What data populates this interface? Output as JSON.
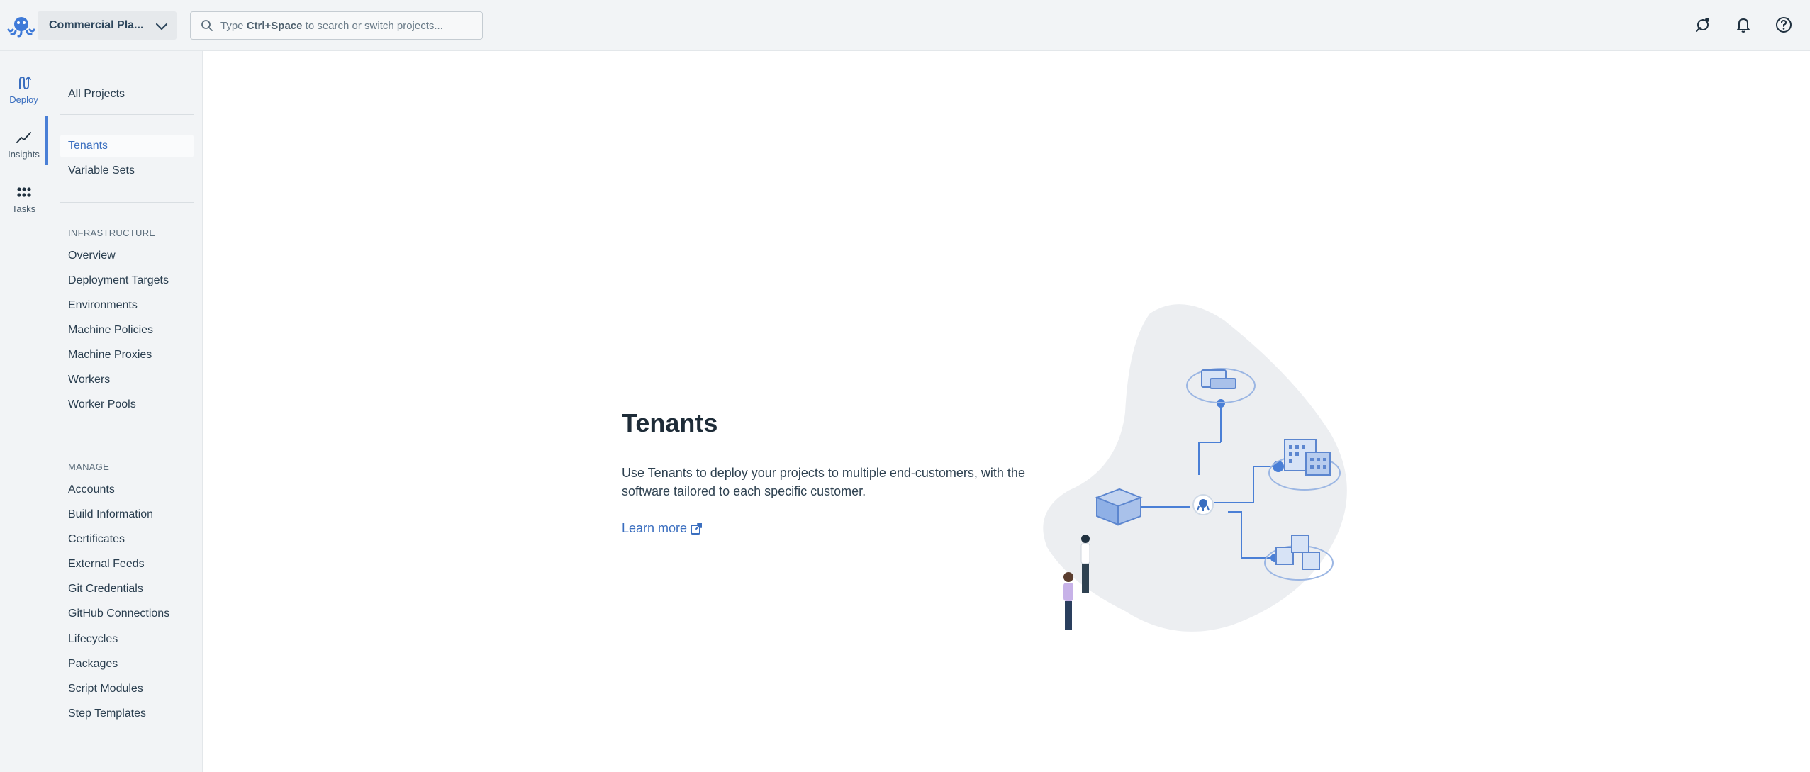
{
  "topbar": {
    "space_name": "Commercial Pla...",
    "search_prefix": "Type ",
    "search_shortcut": "Ctrl+Space",
    "search_suffix": " to search or switch projects..."
  },
  "rail": {
    "items": [
      {
        "label": "Deploy",
        "icon": "deploy-icon"
      },
      {
        "label": "Insights",
        "icon": "insights-icon"
      },
      {
        "label": "Tasks",
        "icon": "tasks-icon"
      }
    ]
  },
  "sidebar": {
    "all_projects": "All Projects",
    "group1": [
      "Tenants",
      "Variable Sets"
    ],
    "infrastructure_heading": "INFRASTRUCTURE",
    "infrastructure": [
      "Overview",
      "Deployment Targets",
      "Environments",
      "Machine Policies",
      "Machine Proxies",
      "Workers",
      "Worker Pools"
    ],
    "manage_heading": "MANAGE",
    "manage": [
      "Accounts",
      "Build Information",
      "Certificates",
      "External Feeds",
      "Git Credentials",
      "GitHub Connections",
      "Lifecycles",
      "Packages",
      "Script Modules",
      "Step Templates"
    ]
  },
  "main": {
    "title": "Tenants",
    "description": "Use Tenants to deploy your projects to multiple end-customers, with the software tailored to each specific customer.",
    "learn_more": "Learn more"
  },
  "colors": {
    "accent": "#3a6ebf",
    "illustration_blob": "#eceef1",
    "illustration_blue": "#4a7fd6"
  }
}
